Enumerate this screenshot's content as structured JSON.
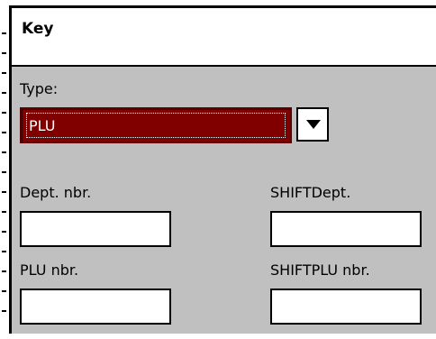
{
  "dialog": {
    "title": "Key"
  },
  "type_field": {
    "label": "Type:",
    "selected": "PLU"
  },
  "fields": {
    "dept_label": "Dept. nbr.",
    "dept_value": "",
    "shift_dept_label": "SHIFTDept.",
    "shift_dept_value": "",
    "plu_label": "PLU nbr.",
    "plu_value": "",
    "shift_plu_label": "SHIFTPLU nbr.",
    "shift_plu_value": ""
  },
  "icons": {
    "dropdown": "triangle-down-icon"
  },
  "colors": {
    "selection": "#800000",
    "panel": "#c0c0c0"
  }
}
